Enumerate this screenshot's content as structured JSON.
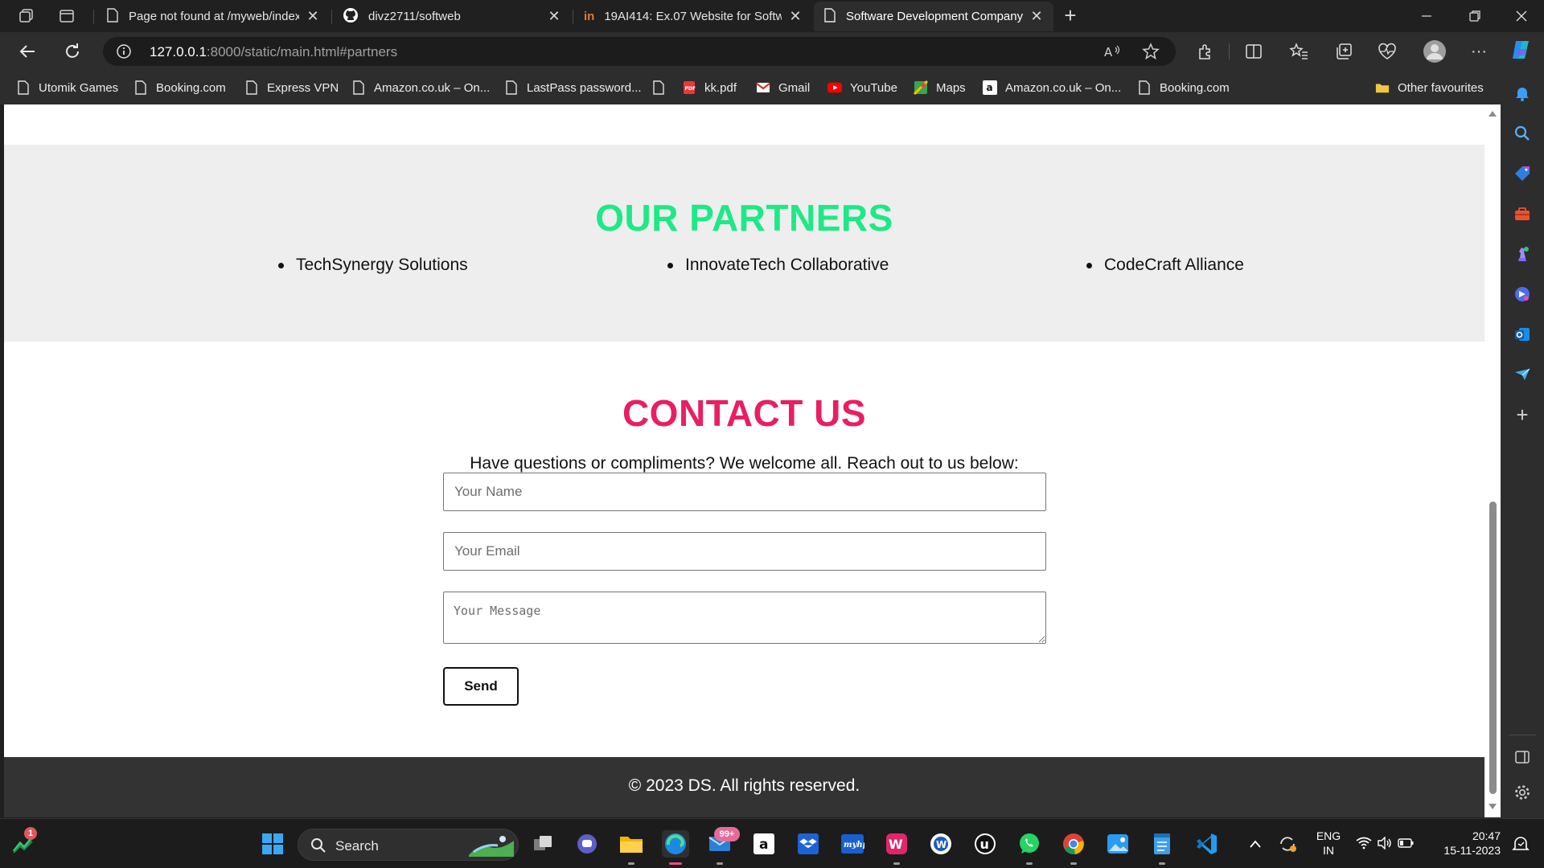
{
  "browser": {
    "tabs": [
      {
        "title": "Page not found at /myweb/index",
        "icon": "document-icon",
        "active": false
      },
      {
        "title": "divz2711/softweb",
        "icon": "github-icon",
        "active": false
      },
      {
        "title": "19AI414: Ex.07 Website for Softw",
        "icon": "in-icon",
        "active": false
      },
      {
        "title": "Software Development Company",
        "icon": "document-icon",
        "active": true
      }
    ],
    "url_host": "127.0.0.1",
    "url_rest": ":8000/static/main.html#partners",
    "bookmarks": [
      "Utomik Games",
      "Booking.com",
      "Express VPN",
      "Amazon.co.uk – On...",
      "LastPass password...",
      "",
      "kk.pdf",
      "Gmail",
      "YouTube",
      "Maps",
      "Amazon.co.uk – On...",
      "Booking.com"
    ],
    "other_favourites": "Other favourites"
  },
  "page": {
    "partners": {
      "heading": "OUR PARTNERS",
      "items": [
        "TechSynergy Solutions",
        "InnovateTech Collaborative",
        "CodeCraft Alliance"
      ]
    },
    "contact": {
      "heading": "CONTACT US",
      "lead": "Have questions or compliments? We welcome all. Reach out to us below:",
      "name_placeholder": "Your Name",
      "email_placeholder": "Your Email",
      "message_placeholder": "Your Message",
      "send_label": "Send"
    },
    "footer": "© 2023 DS. All rights reserved."
  },
  "taskbar": {
    "search_label": "Search",
    "mail_badge": "99+",
    "stocks_badge": "1",
    "language": "ENG",
    "region": "IN",
    "time": "20:47",
    "date": "15-11-2023"
  },
  "colors": {
    "partners_heading": "#1de986",
    "contact_heading": "#e91e63",
    "footer_bg": "#333333",
    "browser_chrome": "#2d2d2d"
  }
}
